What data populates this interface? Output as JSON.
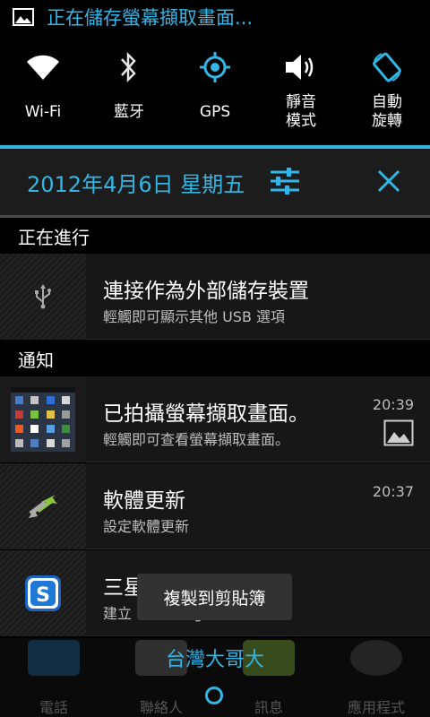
{
  "status_bar": {
    "text": "正在儲存螢幕擷取畫面..."
  },
  "quick_settings": [
    {
      "label": "Wi-Fi",
      "icon": "wifi-icon"
    },
    {
      "label": "藍牙",
      "icon": "bluetooth-icon"
    },
    {
      "label": "GPS",
      "icon": "gps-icon"
    },
    {
      "label": "靜音\n模式",
      "icon": "sound-icon"
    },
    {
      "label": "自動\n旋轉",
      "icon": "auto-rotate-icon"
    }
  ],
  "header": {
    "date": "2012年4月6日 星期五"
  },
  "sections": {
    "ongoing": "正在進行",
    "notifications": "通知"
  },
  "ongoing": [
    {
      "title": "連接作為外部儲存裝置",
      "subtitle": "輕觸即可顯示其他 USB 選項",
      "icon": "usb-icon"
    }
  ],
  "notifications": [
    {
      "title": "已拍攝螢幕擷取畫面。",
      "subtitle": "輕觸即可查看螢幕擷取畫面。",
      "time": "20:39",
      "icon": "screenshot-thumbnail"
    },
    {
      "title": "軟體更新",
      "subtitle": "設定軟體更新",
      "time": "20:37",
      "icon": "software-update-icon"
    },
    {
      "title": "三星帳號",
      "subtitle": "建立 Samsung 帳號",
      "time": "",
      "icon": "samsung-account-icon"
    }
  ],
  "toast": "複製到剪貼簿",
  "carrier": "台灣大哥大",
  "dock": [
    "電話",
    "聯絡人",
    "訊息",
    "應用程式"
  ],
  "colors": {
    "accent": "#33b5e5"
  }
}
